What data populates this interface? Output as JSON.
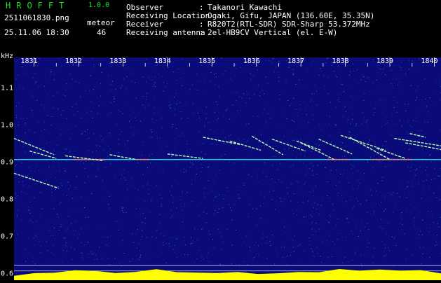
{
  "header": {
    "app_title": "HROFFT",
    "version": "1.0.0",
    "filename": "2511061830.png",
    "datetime": "25.11.06 18:30",
    "meteor_label": "meteor",
    "meteor_count": "46"
  },
  "info": [
    {
      "label": "Observer",
      "value": "Takanori Kawachi"
    },
    {
      "label": "Receiving Location",
      "value": "Ogaki, Gifu, JAPAN (136.60E, 35.35N)"
    },
    {
      "label": "Receiver",
      "value": "R820T2(RTL-SDR) SDR-Sharp 53.372MHz"
    },
    {
      "label": "Receiving antenna",
      "value": "2el-HB9CV Vertical (el. E-W)"
    }
  ],
  "chart_data": {
    "type": "heatmap",
    "ylabel": "kHz",
    "x_ticks": [
      "1831",
      "1832",
      "1833",
      "1834",
      "1835",
      "1836",
      "1837",
      "1838",
      "1839",
      "1840"
    ],
    "y_ticks": [
      "1.1",
      "1.0",
      "0.9",
      "0.8",
      "0.7",
      "0.6"
    ],
    "y_tick_values": [
      1.1,
      1.0,
      0.9,
      0.8,
      0.7,
      0.6
    ],
    "ylim": [
      0.58,
      1.18
    ],
    "xlim": [
      1830.55,
      1840.15
    ],
    "carrier_khz": 0.905,
    "grid_khz": [
      0.62,
      0.605
    ],
    "echoes": [
      {
        "t0": 1830.55,
        "t1": 1831.45,
        "f0": 0.962,
        "f1": 0.918
      },
      {
        "t0": 1830.55,
        "t1": 1831.55,
        "f0": 0.868,
        "f1": 0.828
      },
      {
        "t0": 1830.9,
        "t1": 1831.5,
        "f0": 0.928,
        "f1": 0.908
      },
      {
        "t0": 1831.7,
        "t1": 1832.55,
        "f0": 0.915,
        "f1": 0.902
      },
      {
        "t0": 1832.7,
        "t1": 1833.3,
        "f0": 0.918,
        "f1": 0.905
      },
      {
        "t0": 1834.0,
        "t1": 1834.8,
        "f0": 0.92,
        "f1": 0.908
      },
      {
        "t0": 1834.8,
        "t1": 1835.65,
        "f0": 0.965,
        "f1": 0.945
      },
      {
        "t0": 1835.4,
        "t1": 1836.1,
        "f0": 0.955,
        "f1": 0.93
      },
      {
        "t0": 1835.9,
        "t1": 1836.6,
        "f0": 0.968,
        "f1": 0.918
      },
      {
        "t0": 1836.35,
        "t1": 1837.1,
        "f0": 0.96,
        "f1": 0.928
      },
      {
        "t0": 1836.9,
        "t1": 1837.45,
        "f0": 0.955,
        "f1": 0.93
      },
      {
        "t0": 1837.0,
        "t1": 1837.75,
        "f0": 0.95,
        "f1": 0.905
      },
      {
        "t0": 1837.4,
        "t1": 1838.15,
        "f0": 0.96,
        "f1": 0.92
      },
      {
        "t0": 1837.9,
        "t1": 1838.9,
        "f0": 0.97,
        "f1": 0.93
      },
      {
        "t0": 1838.1,
        "t1": 1839.0,
        "f0": 0.965,
        "f1": 0.905
      },
      {
        "t0": 1838.7,
        "t1": 1839.35,
        "f0": 0.935,
        "f1": 0.908
      },
      {
        "t0": 1839.1,
        "t1": 1840.15,
        "f0": 0.962,
        "f1": 0.942
      },
      {
        "t0": 1839.35,
        "t1": 1840.15,
        "f0": 0.95,
        "f1": 0.932
      },
      {
        "t0": 1839.45,
        "t1": 1839.8,
        "f0": 0.975,
        "f1": 0.965
      }
    ],
    "carrier_bright_segments": [
      [
        1831.9,
        1832.6
      ],
      [
        1833.3,
        1833.6
      ],
      [
        1837.6,
        1838.1
      ],
      [
        1838.6,
        1839.5
      ]
    ],
    "noise_floor_profile": [
      0.3,
      0.5,
      0.6,
      0.9,
      0.7,
      0.5,
      0.6,
      0.9,
      0.6,
      0.5,
      0.5,
      0.6,
      0.5,
      0.5,
      0.6,
      0.7,
      0.9,
      0.8,
      0.9,
      0.7,
      0.8,
      0.5
    ]
  },
  "colors": {
    "background": "#0a0a78",
    "carrier": "#2cf0f0",
    "echo": "#b8ffb8",
    "echo_hot": "#ff6060",
    "noise_fill": "#ffff00",
    "noise_base": "#3090ff",
    "axis_text": "#ffffff",
    "title": "#19e019"
  }
}
